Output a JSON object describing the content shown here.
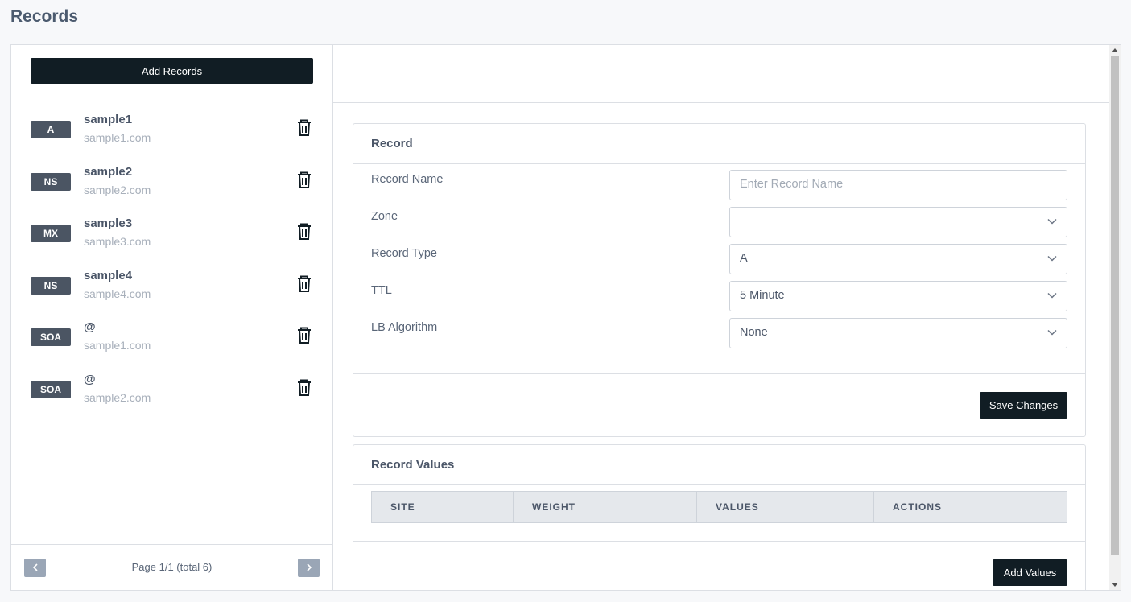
{
  "page": {
    "title": "Records"
  },
  "sidebar": {
    "add_label": "Add Records",
    "records": [
      {
        "type": "A",
        "name": "sample1",
        "domain": "sample1.com"
      },
      {
        "type": "NS",
        "name": "sample2",
        "domain": "sample2.com"
      },
      {
        "type": "MX",
        "name": "sample3",
        "domain": "sample3.com"
      },
      {
        "type": "NS",
        "name": "sample4",
        "domain": "sample4.com"
      },
      {
        "type": "SOA",
        "name": "@",
        "domain": "sample1.com"
      },
      {
        "type": "SOA",
        "name": "@",
        "domain": "sample2.com"
      }
    ],
    "pagination": {
      "text": "Page 1/1 (total 6)",
      "prev_icon": "chevron-left-icon",
      "next_icon": "chevron-right-icon"
    }
  },
  "record_card": {
    "title": "Record",
    "fields": {
      "record_name": {
        "label": "Record Name",
        "placeholder": "Enter Record Name",
        "value": ""
      },
      "zone": {
        "label": "Zone",
        "value": ""
      },
      "record_type": {
        "label": "Record Type",
        "value": "A"
      },
      "ttl": {
        "label": "TTL",
        "value": "5 Minute"
      },
      "lb_algorithm": {
        "label": "LB Algorithm",
        "value": "None"
      }
    },
    "save_label": "Save Changes"
  },
  "values_card": {
    "title": "Record Values",
    "columns": [
      "SITE",
      "WEIGHT",
      "VALUES",
      "ACTIONS"
    ],
    "add_label": "Add Values"
  },
  "colors": {
    "dark_button": "#111d24",
    "badge": "#4b5563",
    "pager_button": "#9aa6b6"
  }
}
